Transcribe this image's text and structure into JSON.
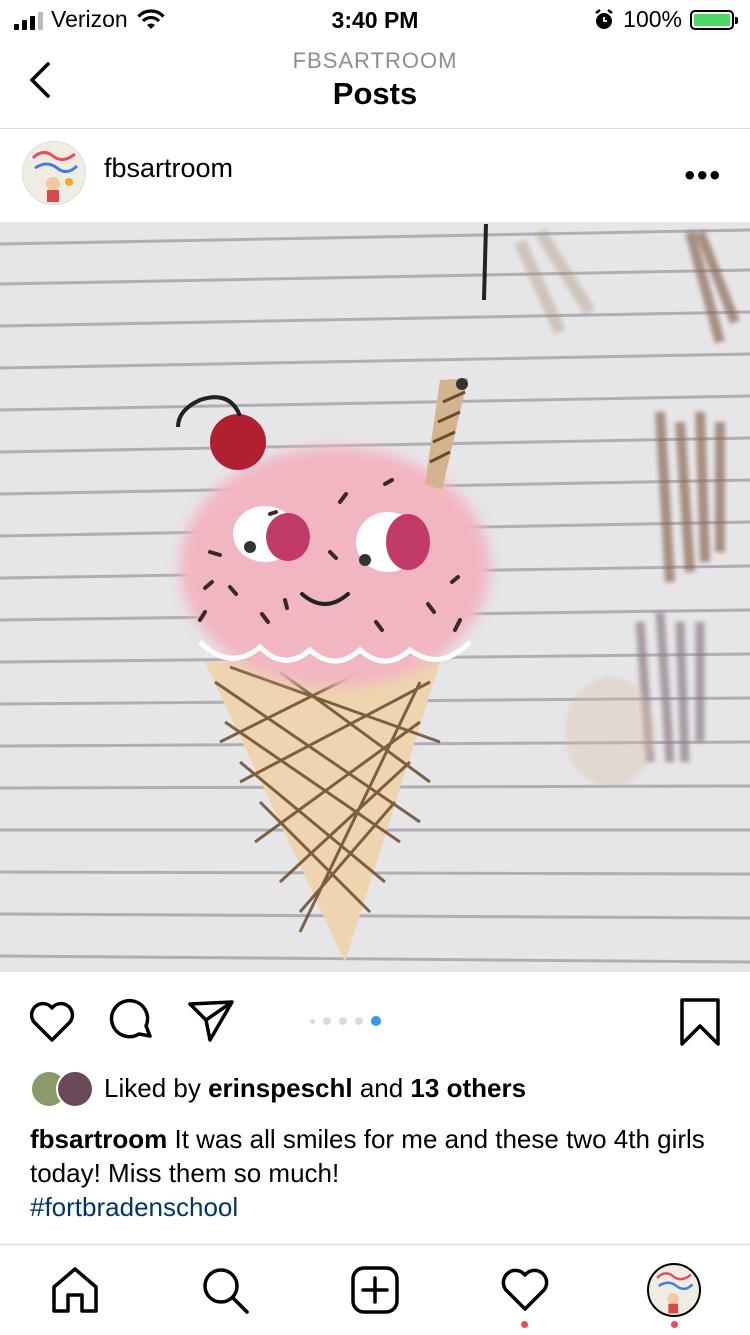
{
  "status": {
    "carrier": "Verizon",
    "time": "3:40 PM",
    "battery": "100%"
  },
  "header": {
    "subtitle": "FBSARTROOM",
    "title": "Posts"
  },
  "post": {
    "username": "fbsartroom",
    "more_label": "•••",
    "carousel": {
      "count": 5,
      "active_index": 4
    },
    "likes": {
      "prefix": "Liked by ",
      "first_user": "erinspeschl",
      "middle": " and ",
      "others": "13 others"
    },
    "caption": {
      "author": "fbsartroom",
      "text": " It was all smiles for me and these two 4th girls today!  Miss them so much!",
      "hashtag": "#fortbradenschool"
    }
  },
  "colors": {
    "accent_blue": "#3897f0",
    "hashtag": "#003569",
    "notification": "#ed4956",
    "battery": "#4cd964"
  },
  "icons": [
    "back-chevron-icon",
    "alarm-icon",
    "battery-icon",
    "heart-icon",
    "comment-icon",
    "share-icon",
    "bookmark-icon",
    "home-icon",
    "search-icon",
    "add-icon",
    "activity-heart-icon",
    "profile-avatar-icon"
  ]
}
